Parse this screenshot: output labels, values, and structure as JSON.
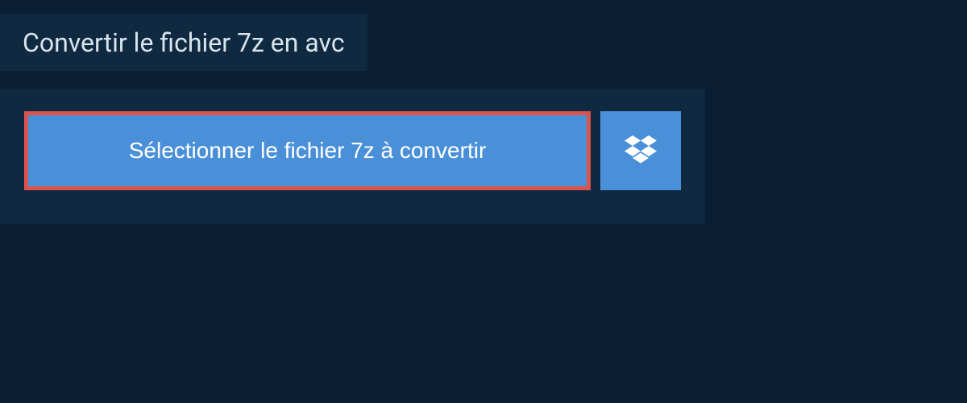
{
  "header": {
    "title": "Convertir le fichier 7z en avc"
  },
  "upload": {
    "select_button_label": "Sélectionner le fichier 7z à convertir"
  }
}
